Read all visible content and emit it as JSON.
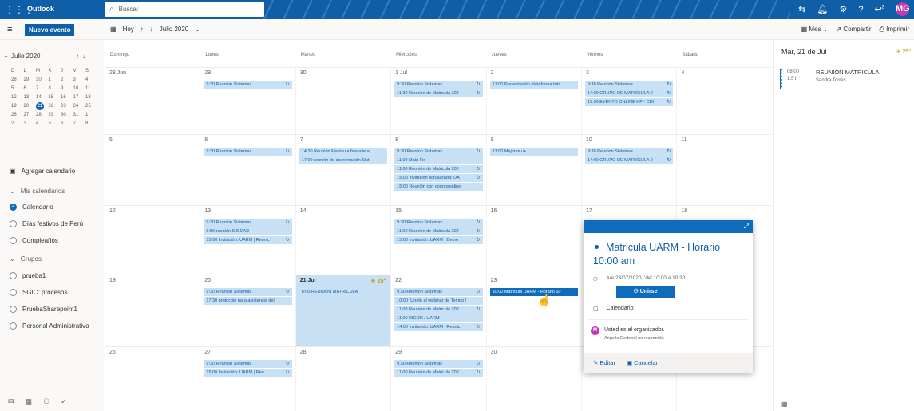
{
  "topbar": {
    "app_title": "Outlook",
    "search_placeholder": "Buscar",
    "avatar_initials": "MG",
    "icons": [
      "waffle-icon",
      "search-icon",
      "skype-icon",
      "bell-icon",
      "settings-icon",
      "help-icon",
      "feedback-icon"
    ],
    "notification_badge": "2"
  },
  "toolbar": {
    "new_event_label": "Nuevo evento",
    "today_label": "Hoy",
    "month_label": "Julio 2020",
    "view_label": "Mes",
    "share_label": "Compartir",
    "print_label": "Imprimir"
  },
  "sidebar": {
    "mini_title": "Julio 2020",
    "weekday_letters": [
      "D",
      "L",
      "M",
      "X",
      "J",
      "V",
      "S"
    ],
    "mini_weeks": [
      [
        "28",
        "29",
        "30",
        "1",
        "2",
        "3",
        "4"
      ],
      [
        "5",
        "6",
        "7",
        "8",
        "9",
        "10",
        "11"
      ],
      [
        "12",
        "13",
        "14",
        "15",
        "16",
        "17",
        "18"
      ],
      [
        "19",
        "20",
        "21",
        "22",
        "23",
        "24",
        "25"
      ],
      [
        "26",
        "27",
        "28",
        "29",
        "30",
        "31",
        "1"
      ],
      [
        "2",
        "3",
        "4",
        "5",
        "6",
        "7",
        "8"
      ]
    ],
    "mini_today": "21",
    "add_calendar": "Agregar calendario",
    "my_calendars": "Mis calendarios",
    "calendars": [
      {
        "label": "Calendario",
        "checked": true
      },
      {
        "label": "Días festivos de Perú",
        "checked": false
      },
      {
        "label": "Cumpleaños",
        "checked": false
      }
    ],
    "groups_label": "Grupos",
    "groups": [
      "prueba1",
      "SGIC: procesos",
      "PruebaSharepoint1",
      "Personal Administrativo"
    ]
  },
  "calendar": {
    "day_names": [
      "Domingo",
      "Lunes",
      "Martes",
      "Miércoles",
      "Jueves",
      "Viernes",
      "Sábado"
    ],
    "weeks": [
      {
        "days": [
          {
            "n": "28 Jun",
            "events": []
          },
          {
            "n": "29",
            "events": [
              {
                "t": "9:30 Reunion Sistemas",
                "s": true
              }
            ]
          },
          {
            "n": "30",
            "events": []
          },
          {
            "n": "1 Jul",
            "events": [
              {
                "t": "9:30 Reunion Sistemas",
                "s": true
              },
              {
                "t": "11:30 Reunión de Matricula 202",
                "s": true,
                "plain": true
              }
            ]
          },
          {
            "n": "2",
            "events": [
              {
                "t": "17:00 Presentación plataforma trár"
              }
            ]
          },
          {
            "n": "3",
            "events": [
              {
                "t": "9:30 Reunion Sistemas",
                "s": true
              },
              {
                "t": "14:00 GRUPO DE MATRÍCULA 2",
                "s": true
              },
              {
                "t": "19:00 EVENTO ONLINE HP - CDI",
                "s": true
              }
            ]
          },
          {
            "n": "4",
            "events": []
          }
        ]
      },
      {
        "days": [
          {
            "n": "5",
            "events": []
          },
          {
            "n": "6",
            "events": [
              {
                "t": "9:30 Reunion Sistemas",
                "s": true
              }
            ]
          },
          {
            "n": "7",
            "events": [
              {
                "t": "14:30 Reunión Matricula financiera"
              },
              {
                "t": "17:00 reunión de coordinación Sist"
              }
            ]
          },
          {
            "n": "8",
            "events": [
              {
                "t": "9:30 Reunion Sistemas",
                "s": true
              },
              {
                "t": "11:00 Matri Fin"
              },
              {
                "t": "11:00 Reunión de Matricula 202",
                "s": true,
                "plain": true
              },
              {
                "t": "15:00 Invitación actualizada: UA",
                "s": true
              },
              {
                "t": "15:00 Reunión con cognosonline"
              }
            ]
          },
          {
            "n": "9",
            "events": [
              {
                "t": "17:00 Mejoras u+"
              }
            ]
          },
          {
            "n": "10",
            "events": [
              {
                "t": "9:30 Reunion Sistemas",
                "s": true
              },
              {
                "t": "14:00 GRUPO DE MATRÍCULA 2",
                "s": true,
                "plain": true
              }
            ]
          },
          {
            "n": "11",
            "events": []
          }
        ]
      },
      {
        "days": [
          {
            "n": "12",
            "events": []
          },
          {
            "n": "13",
            "events": [
              {
                "t": "9:30 Reunion Sistemas",
                "s": true
              },
              {
                "t": "9:50 reunión SIS EAD"
              },
              {
                "t": "15:00 Invitación: UARM | Reunic",
                "s": true
              }
            ]
          },
          {
            "n": "14",
            "events": []
          },
          {
            "n": "15",
            "events": [
              {
                "t": "9:30 Reunion Sistemas",
                "s": true
              },
              {
                "t": "11:00 Reunión de Matricula 202",
                "s": true,
                "plain": true
              },
              {
                "t": "15:00 Invitación: UARM | Demo",
                "s": true
              }
            ]
          },
          {
            "n": "16",
            "events": []
          },
          {
            "n": "17",
            "events": []
          },
          {
            "n": "18",
            "events": []
          }
        ]
      },
      {
        "days": [
          {
            "n": "19",
            "events": []
          },
          {
            "n": "20",
            "events": [
              {
                "t": "9:30 Reunion Sistemas",
                "s": true
              },
              {
                "t": "17:30 protocolo para asistencia del",
                "plain": true
              }
            ]
          },
          {
            "n": "21 Jul",
            "today": true,
            "weather": "☀ 25°",
            "events": [
              {
                "t": "8:00 REUNIÓN MATRICULA",
                "plain": true
              }
            ]
          },
          {
            "n": "22",
            "events": [
              {
                "t": "9:30 Reunion Sistemas",
                "s": true
              },
              {
                "t": "10:00 ¡Únete al webinar de Tempo !",
                "plain": true
              },
              {
                "t": "11:00 Reunión de Matricula 202",
                "s": true,
                "plain": true
              },
              {
                "t": "11:00 RICOH / UARM",
                "plain": true
              },
              {
                "t": "14:00 Invitación: UARM | Reunic",
                "s": true,
                "plain": true
              }
            ]
          },
          {
            "n": "23",
            "events": [
              {
                "t": "10:00 Matricula UARM - Horario 10",
                "dark": true
              }
            ]
          },
          {
            "n": "24",
            "events": []
          },
          {
            "n": "25",
            "events": []
          }
        ]
      },
      {
        "days": [
          {
            "n": "26",
            "events": []
          },
          {
            "n": "27",
            "events": [
              {
                "t": "9:30 Reunion Sistemas",
                "s": true
              },
              {
                "t": "15:00 Invitación: UARM | Reu",
                "s": true,
                "plain": true
              }
            ]
          },
          {
            "n": "28",
            "events": []
          },
          {
            "n": "29",
            "events": [
              {
                "t": "9:30 Reunion Sistemas",
                "s": true
              },
              {
                "t": "11:00 Reunión de Matricula 202",
                "s": true,
                "plain": true
              }
            ]
          },
          {
            "n": "30",
            "events": []
          },
          {
            "n": "31",
            "events": [
              {
                "t": "14:00 GRUPO DE MATRÍCULA 2",
                "s": true,
                "plain": true
              }
            ]
          },
          {
            "n": "1",
            "events": []
          }
        ]
      }
    ]
  },
  "popup": {
    "title": "Matricula UARM - Horario 10:00 am",
    "when": "Jue 23/07/2020, 'de' 10:00 a 10:30",
    "join_label": "Unirse",
    "calendar_label": "Calendario",
    "organizer_text": "Usted es el organizador.",
    "organizer_sub": "Angello Godenal no respondió.",
    "organizer_initial": "M",
    "edit_label": "Editar",
    "cancel_label": "Cancelar"
  },
  "rightpane": {
    "date": "Mar, 21 de Jul",
    "weather": "☀ 25°",
    "event_time": "08:00",
    "event_duration": "1.5 h",
    "event_title": "REUNIÓN MATRICULA",
    "event_org": "Sandra Torres"
  },
  "colors": {
    "accent": "#0f6cbd",
    "event_bg": "#c7e0f4",
    "today_bg": "#c7e0f4"
  }
}
